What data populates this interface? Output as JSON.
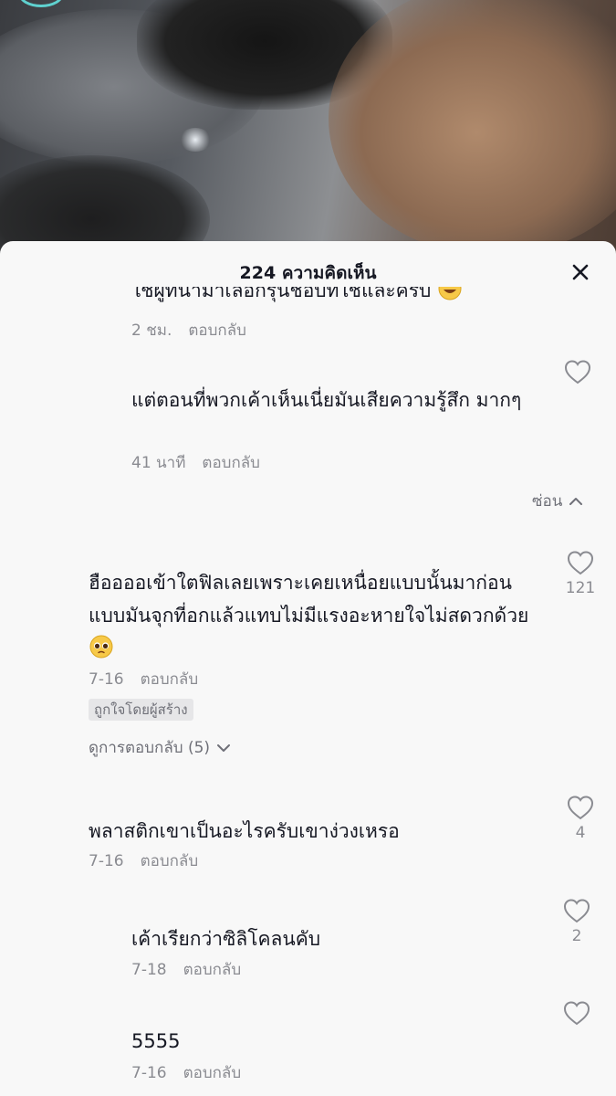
{
  "header": {
    "title": "224 ความคิดเห็น"
  },
  "comments": [
    {
      "text": "ใช้ผู้ที่นำมาเลือกรุ่นชอบที่ใช้และครับ",
      "emoji": "grinning-emoji",
      "time": "2 ชม.",
      "reply_label": "ตอบกลับ",
      "is_reply": true,
      "clipped": true
    },
    {
      "text": "แต่ตอนที่พวกเค้าเห็นเนี่ยมันเสียความรู้สึก มากๆ",
      "time": "41 นาที",
      "reply_label": "ตอบกลับ",
      "is_reply": true,
      "likes": ""
    },
    {
      "hide_label": "ซ่อน"
    },
    {
      "text": "ฮืออออเข้าใตฟิลเลยเพราะเคยเหนื่อยแบบนั้นมาก่อนแบบมันจุกที่อกแล้วแทบไม่มีแรงอะหายใจไม่สดวกด้วย",
      "emoji": "pleading-face-emoji",
      "time": "7-16",
      "reply_label": "ตอบกลับ",
      "likes": "121",
      "creator_badge": "ถูกใจโดยผู้สร้าง",
      "view_replies": "ดูการตอบกลับ (5)"
    },
    {
      "text": "พลาสติกเขาเป็นอะไรครับเขาง่วงเหรอ",
      "time": "7-16",
      "reply_label": "ตอบกลับ",
      "likes": "4"
    },
    {
      "text": "เค้าเรียกว่าซิลิโคลนคับ",
      "time": "7-18",
      "reply_label": "ตอบกลับ",
      "is_reply": true,
      "likes": "2"
    },
    {
      "text": "5555",
      "time": "7-16",
      "reply_label": "ตอบกลับ",
      "is_reply": true,
      "likes": ""
    }
  ],
  "icons": {
    "close": "close-icon",
    "heart": "heart-outline-icon",
    "chevron_up": "chevron-up-icon",
    "chevron_down": "chevron-down-icon"
  },
  "colors": {
    "sheet_bg": "#f8f8f8",
    "text_primary": "#161823",
    "text_secondary": "#8a8b91"
  }
}
